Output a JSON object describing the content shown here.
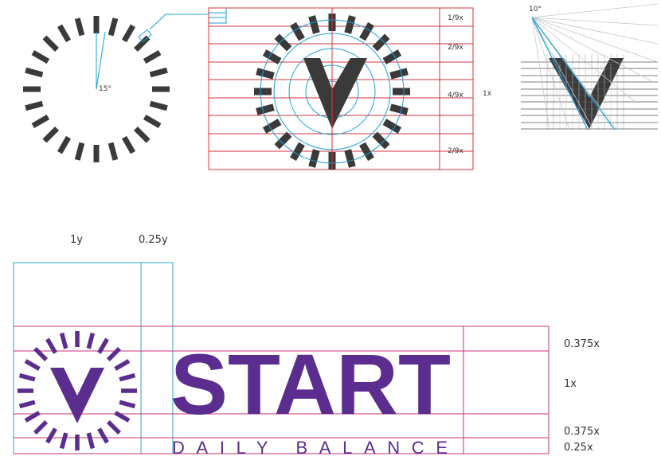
{
  "colors": {
    "tick": "#3a3a3a",
    "blue": "#1aa0d8",
    "red": "#d6343c",
    "magenta": "#c8307a",
    "teal": "#2aa8c0",
    "purple": "#5b2d8e",
    "gridGray": "#bbbbbb"
  },
  "clock_diagram": {
    "angle_label": "15°",
    "icon": "magnifier-icon"
  },
  "grid_diagram": {
    "row_labels": [
      "1/9x",
      "2/9x",
      "4/9x",
      "2/9x"
    ],
    "side_label": "1x"
  },
  "angle_diagram": {
    "angle_label": "10°"
  },
  "logo_lockup": {
    "top_labels": [
      "1y",
      "0.25y"
    ],
    "wordmark": "START",
    "tagline": "DAILY BALANCE",
    "right_labels": [
      "0.375x",
      "1x",
      "0.375x",
      "0.25x"
    ]
  }
}
